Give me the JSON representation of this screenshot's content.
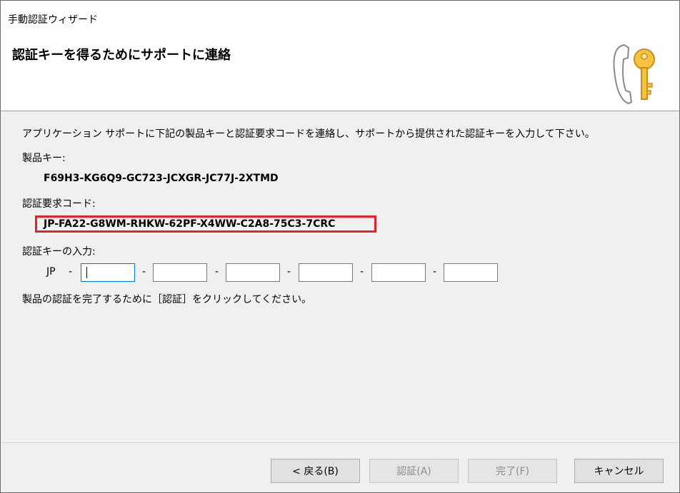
{
  "window": {
    "title": "手動認証ウィザード"
  },
  "header": {
    "heading": "認証キーを得るためにサポートに連絡",
    "icon": "phone-key-icon"
  },
  "main": {
    "instruction": "アプリケーション サポートに下記の製品キーと認証要求コードを連絡し、サポートから提供された認証キーを入力して下さい。",
    "product_key_label": "製品キー:",
    "product_key_value": "F69H3-KG6Q9-GC723-JCXGR-JC77J-2XTMD",
    "request_code_label": "認証要求コード:",
    "request_code_value": "JP-FA22-G8WM-RHKW-62PF-X4WW-C2A8-75C3-7CRC",
    "auth_key_label": "認証キーの入力:",
    "auth_key_prefix": "JP",
    "separator": "-",
    "auth_key_fields": [
      "",
      "",
      "",
      "",
      "",
      ""
    ],
    "complete_note": "製品の認証を完了するために［認証］をクリックしてください。"
  },
  "footer": {
    "back_label": "< 戻る(B)",
    "activate_label": "認証(A)",
    "finish_label": "完了(F)",
    "cancel_label": "キャンセル"
  },
  "colors": {
    "highlight_border": "#e0242c",
    "focus_border": "#0078d7"
  }
}
